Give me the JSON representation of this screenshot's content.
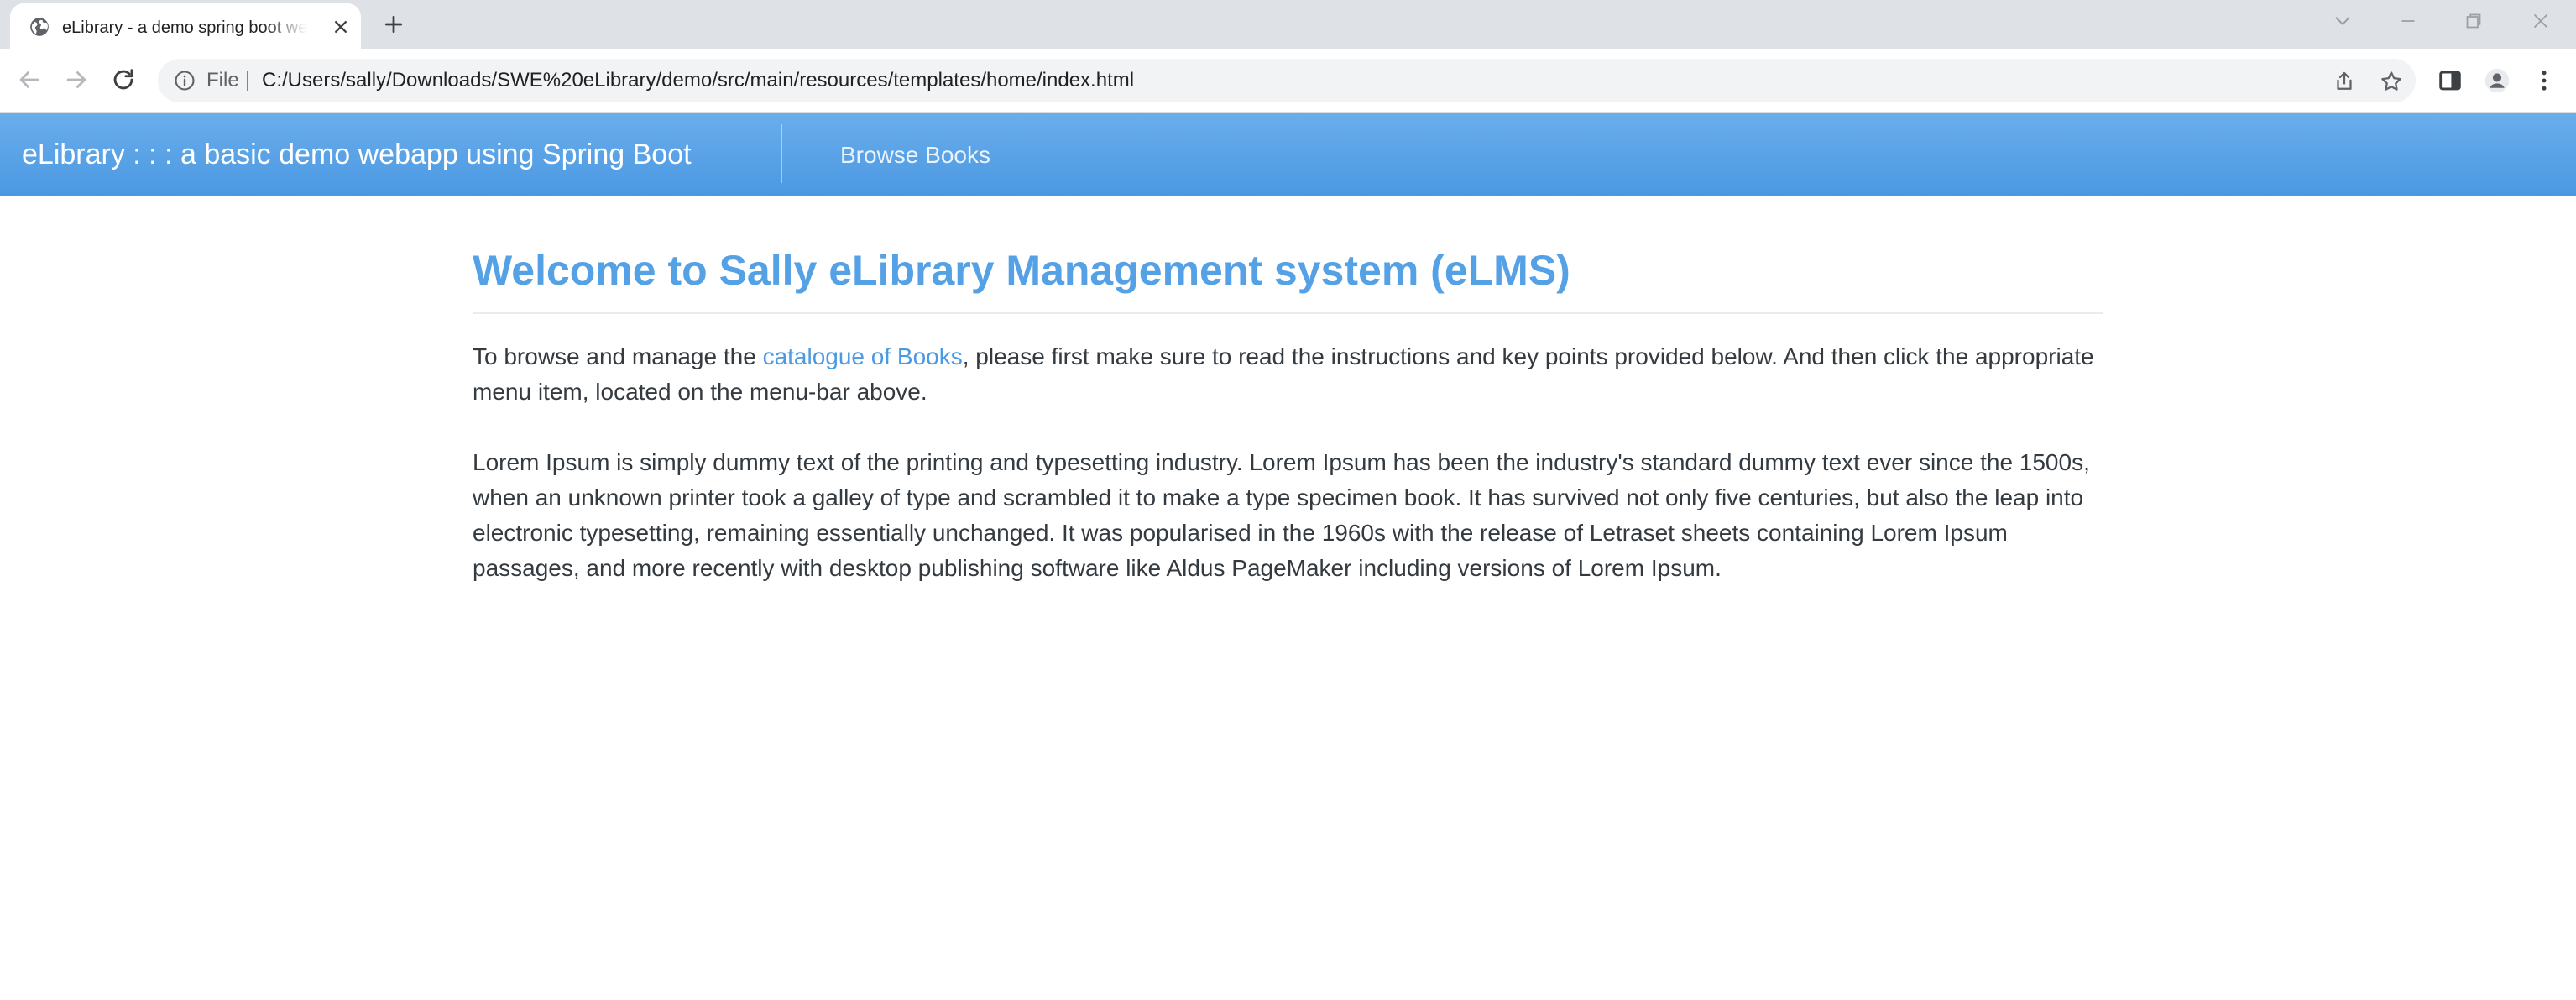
{
  "browser": {
    "tab": {
      "title": "eLibrary - a demo spring boot webapp using Spring Boot",
      "favicon": "globe-icon",
      "close_icon": "close-icon"
    },
    "new_tab_icon": "plus-icon",
    "window_controls": [
      "chevron-down-icon",
      "minimize-icon",
      "restore-icon",
      "close-icon"
    ],
    "toolbar": {
      "back_icon": "arrow-left-icon",
      "forward_icon": "arrow-right-icon",
      "reload_icon": "reload-icon",
      "site_info_icon": "info-icon",
      "scheme_label": "File",
      "url": "C:/Users/sally/Downloads/SWE%20eLibrary/demo/src/main/resources/templates/home/index.html",
      "share_icon": "share-icon",
      "bookmark_icon": "star-icon",
      "side_panel_icon": "side-panel-icon",
      "profile_icon": "profile-icon",
      "menu_icon": "kebab-menu-icon"
    }
  },
  "app": {
    "navbar": {
      "brand": "eLibrary : : : a basic demo webapp using Spring Boot",
      "links": [
        {
          "label": "Browse Books"
        }
      ]
    },
    "main": {
      "title": "Welcome to Sally eLibrary Management system (eLMS)",
      "intro": {
        "before_link": "To browse and manage the ",
        "link_text": "catalogue of Books",
        "after_link": ", please first make sure to read the instructions and key points provided below. And then click the appropriate menu item, located on the menu-bar above."
      },
      "body": "Lorem Ipsum is simply dummy text of the printing and typesetting industry. Lorem Ipsum has been the industry's standard dummy text ever since the 1500s, when an unknown printer took a galley of type and scrambled it to make a type specimen book. It has survived not only five centuries, but also the leap into electronic typesetting, remaining essentially unchanged. It was popularised in the 1960s with the release of Letraset sheets containing Lorem Ipsum passages, and more recently with desktop publishing software like Aldus PageMaker including versions of Lorem Ipsum."
    }
  },
  "colors": {
    "navbar_top": "#6aaeec",
    "navbar_bottom": "#4b98e2",
    "title": "#55a1e6",
    "link": "#4a9ae3",
    "body_text": "#333a40",
    "tabstrip": "#dee1e6"
  }
}
